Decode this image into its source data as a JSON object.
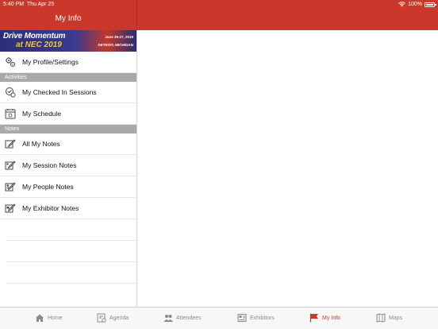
{
  "status_bar": {
    "time": "5:40 PM",
    "date": "Thu Apr 25",
    "battery": "100%"
  },
  "header": {
    "title": "My Info",
    "color": "#c9382a"
  },
  "banner": {
    "title": "Drive Momentum",
    "subtitle": "at NEC 2019",
    "dates": "June 25-27, 2019",
    "location": "DETROIT, MICHIGAN"
  },
  "sidebar": {
    "profile": {
      "label": "My Profile/Settings",
      "icon": "gears-icon"
    },
    "sections": [
      {
        "title": "Activities",
        "items": [
          {
            "label": "My Checked In Sessions",
            "icon": "checked-in-icon"
          },
          {
            "label": "My Schedule",
            "icon": "schedule-icon"
          }
        ]
      },
      {
        "title": "Notes",
        "items": [
          {
            "label": "All My Notes",
            "icon": "notes-icon"
          },
          {
            "label": "My Session Notes",
            "icon": "session-notes-icon"
          },
          {
            "label": "My People Notes",
            "icon": "people-notes-icon"
          },
          {
            "label": "My Exhibitor Notes",
            "icon": "exhibitor-notes-icon"
          }
        ]
      }
    ]
  },
  "tabbar": {
    "tabs": [
      {
        "label": "Home",
        "icon": "home-icon"
      },
      {
        "label": "Agenda",
        "icon": "agenda-icon"
      },
      {
        "label": "Attendees",
        "icon": "attendees-icon"
      },
      {
        "label": "Exhibitors",
        "icon": "exhibitors-icon"
      },
      {
        "label": "My Info",
        "icon": "flag-icon",
        "active": true
      },
      {
        "label": "Maps",
        "icon": "map-icon"
      }
    ],
    "active_color": "#c9382a"
  }
}
